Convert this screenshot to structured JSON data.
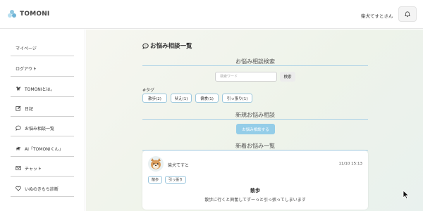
{
  "header": {
    "logo_text": "TOMONI",
    "user_name": "柴犬てすとさん"
  },
  "sidebar": {
    "items": [
      {
        "label": "マイページ",
        "icon": "none"
      },
      {
        "label": "ログアウト",
        "icon": "none"
      },
      {
        "label": "TOMONIとは。",
        "icon": "dog-icon"
      },
      {
        "label": "日記",
        "icon": "edit-icon"
      },
      {
        "label": "お悩み相談一覧",
        "icon": "chat-bubble-icon"
      },
      {
        "label": "AI「TOMONIくん」",
        "icon": "dog-icon"
      },
      {
        "label": "チャット",
        "icon": "envelope-icon"
      },
      {
        "label": "いぬのきもち診断",
        "icon": "heart-icon"
      }
    ]
  },
  "main": {
    "page_title": "お悩み相談一覧",
    "search": {
      "section_title": "お悩み相談検索",
      "placeholder": "検索ワード",
      "button_label": "検索"
    },
    "tags": {
      "label": "#タグ",
      "items": [
        "散歩(2)",
        "吠え(1)",
        "偏食(1)",
        "引っ張り(1)"
      ]
    },
    "new_post": {
      "section_title": "新規お悩み相談",
      "button_label": "お悩み相談する"
    },
    "recent": {
      "section_title": "新着お悩み一覧",
      "posts": [
        {
          "author": "柴犬てすと",
          "time": "11/10 15:13",
          "tags": [
            "散歩",
            "引っ張り"
          ],
          "title": "散歩",
          "body": "散歩に行くと興奮してずーっと引っ張ってしまいます"
        }
      ]
    }
  },
  "colors": {
    "accent": "#94cde8",
    "tag_border": "#9cc7de",
    "section_line": "#a9d0e6"
  }
}
